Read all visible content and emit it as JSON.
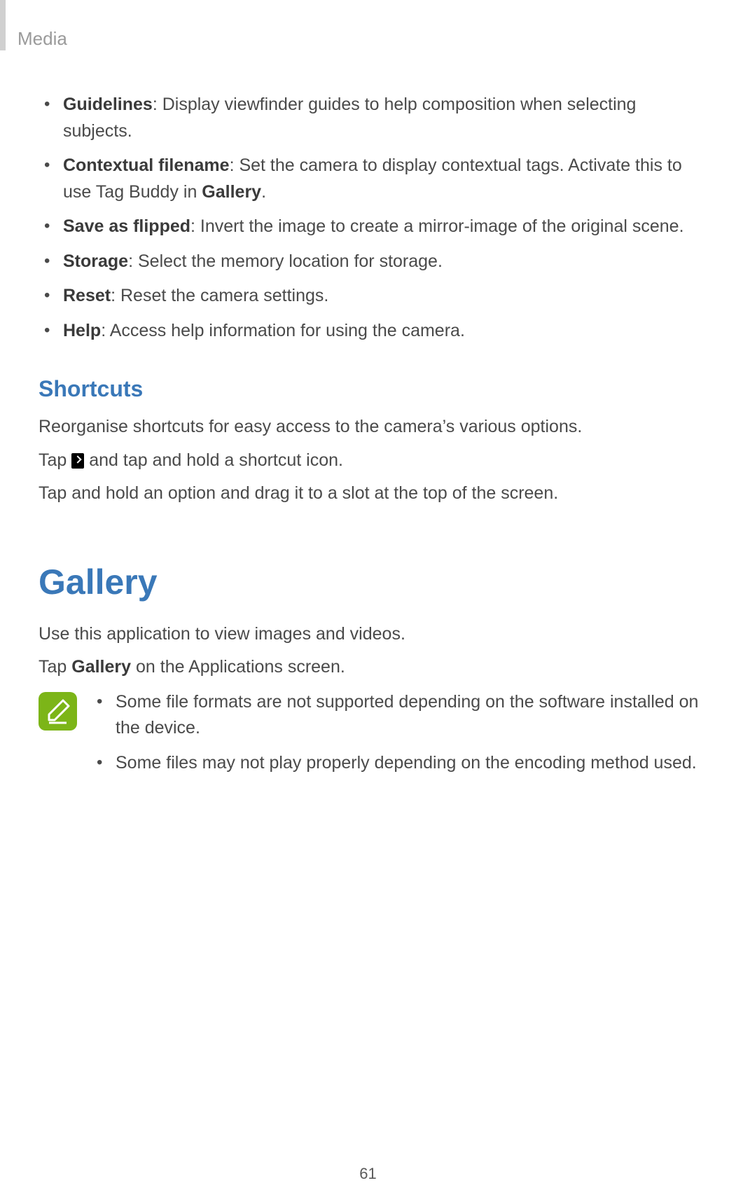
{
  "header": {
    "section": "Media"
  },
  "settings_list": [
    {
      "term": "Guidelines",
      "desc": ": Display viewfinder guides to help composition when selecting subjects."
    },
    {
      "term": "Contextual filename",
      "desc_a": ": Set the camera to display contextual tags. Activate this to use Tag Buddy in ",
      "bold_in_desc": "Gallery",
      "desc_b": "."
    },
    {
      "term": "Save as flipped",
      "desc": ": Invert the image to create a mirror-image of the original scene."
    },
    {
      "term": "Storage",
      "desc": ": Select the memory location for storage."
    },
    {
      "term": "Reset",
      "desc": ": Reset the camera settings."
    },
    {
      "term": "Help",
      "desc": ": Access help information for using the camera."
    }
  ],
  "shortcuts": {
    "heading": "Shortcuts",
    "p1": "Reorganise shortcuts for easy access to the camera’s various options.",
    "p2a": "Tap ",
    "p2b": " and tap and hold a shortcut icon.",
    "p3": "Tap and hold an option and drag it to a slot at the top of the screen."
  },
  "gallery": {
    "heading": "Gallery",
    "p1": "Use this application to view images and videos.",
    "p2a": "Tap ",
    "p2bold": "Gallery",
    "p2b": " on the Applications screen.",
    "notes": [
      "Some file formats are not supported depending on the software installed on the device.",
      "Some files may not play properly depending on the encoding method used."
    ]
  },
  "page_number": "61"
}
